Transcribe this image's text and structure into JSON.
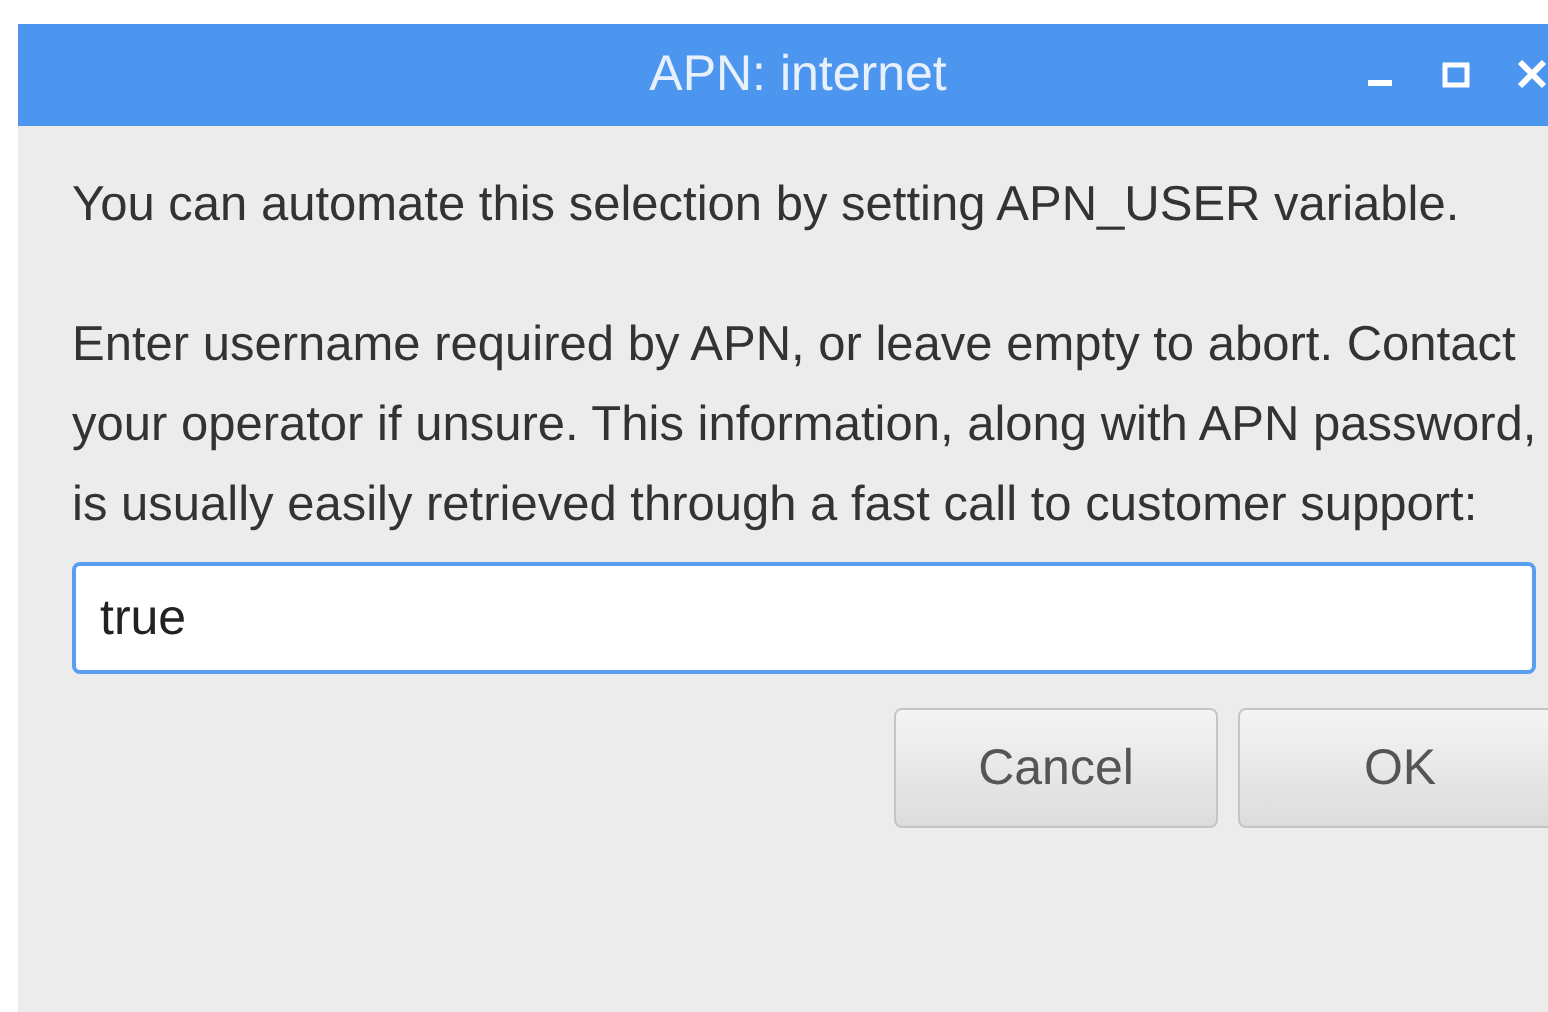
{
  "window": {
    "title": "APN: internet"
  },
  "paragraphs": [
    "You can automate this selection by setting APN_USER variable.",
    "Enter username required by APN, or leave empty to abort. Contact your operator if unsure. This information, along with APN password, is usually easily retrieved through a fast call to customer support:"
  ],
  "input": {
    "value": "true"
  },
  "buttons": [
    "Cancel",
    "OK"
  ]
}
